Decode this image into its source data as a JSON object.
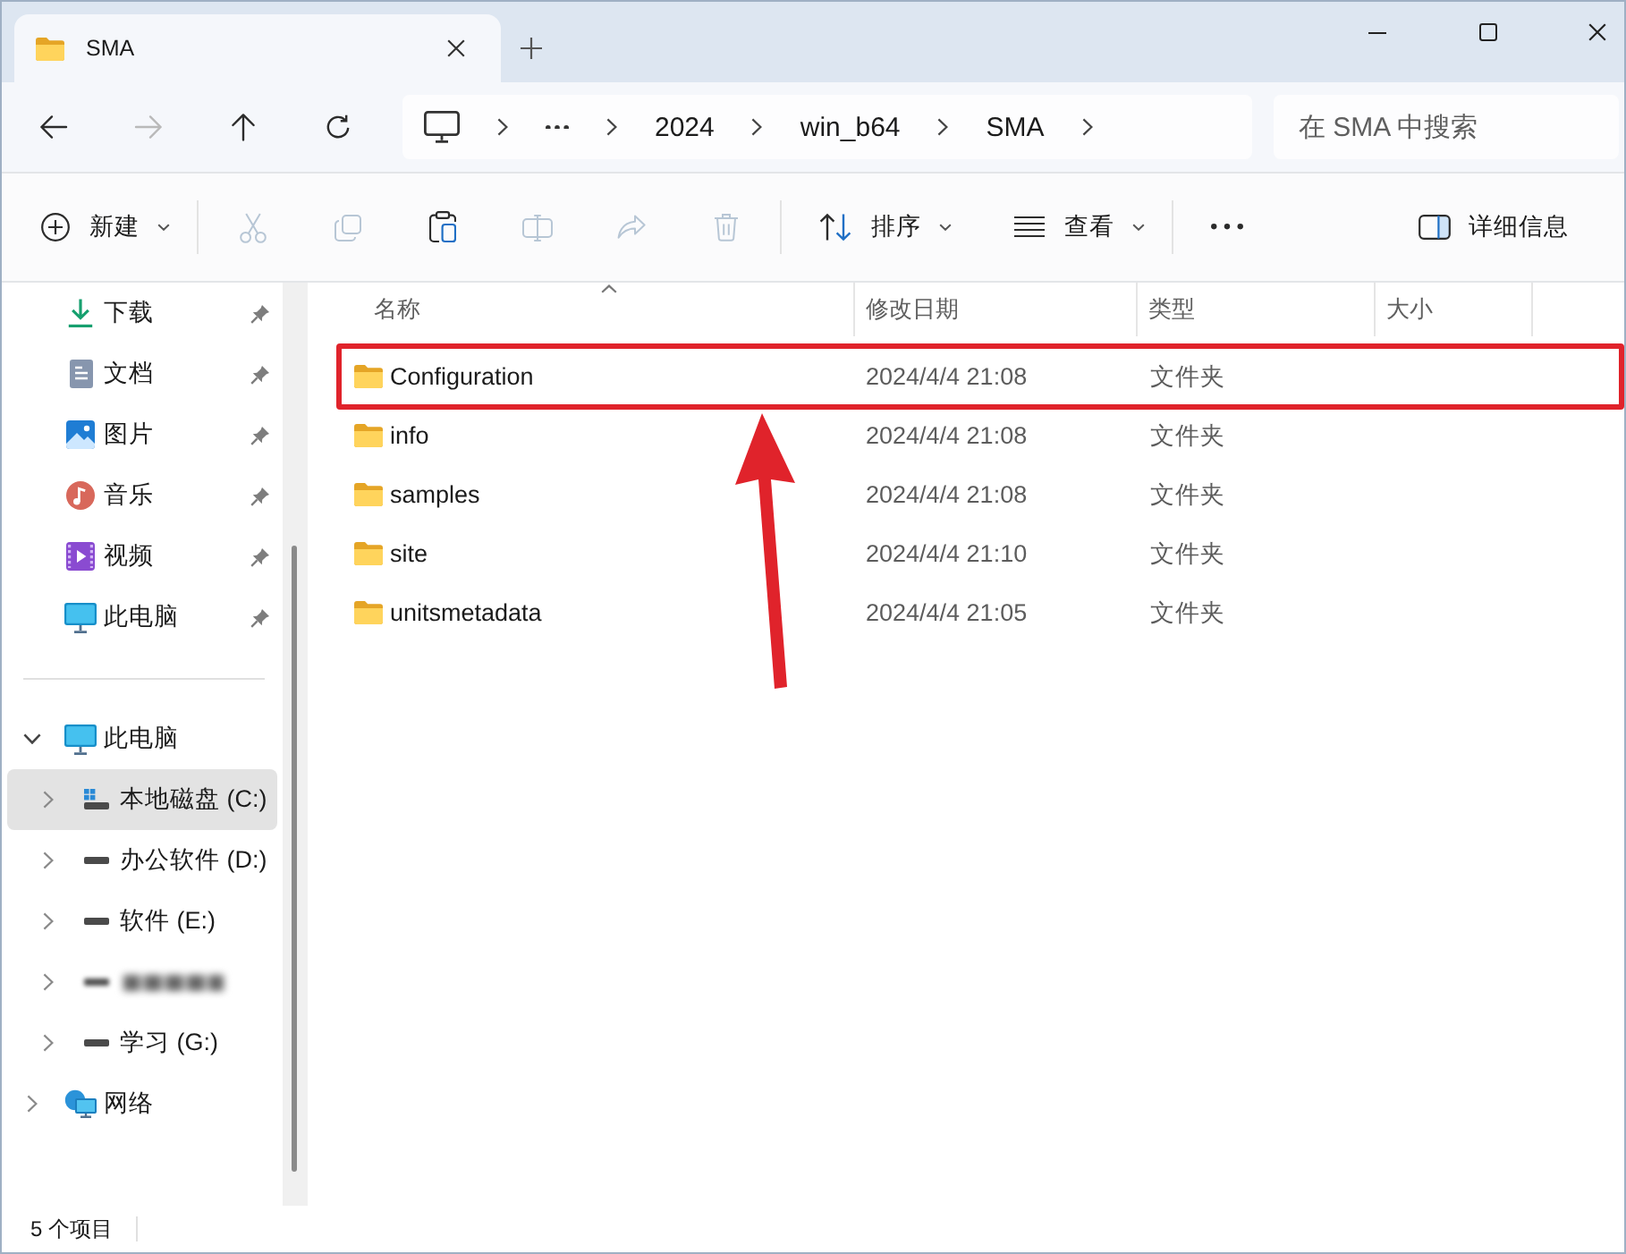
{
  "window": {
    "tab": {
      "title": "SMA",
      "selected": true
    }
  },
  "address_bar": {
    "nav_buttons": [
      {
        "kind": "back",
        "disabled": false
      },
      {
        "kind": "forward",
        "disabled": true
      },
      {
        "kind": "up",
        "disabled": false
      },
      {
        "kind": "refresh",
        "disabled": false
      }
    ],
    "breadcrumb": [
      "2024",
      "win_b64",
      "SMA"
    ],
    "search": {
      "placeholder": "在 SMA 中搜索"
    }
  },
  "toolbar": {
    "groups": [
      [
        {
          "kind": "new",
          "label": "新建",
          "dropdown": true,
          "disabled": false
        }
      ],
      [
        {
          "kind": "cut",
          "dropdown": false,
          "disabled": true
        },
        {
          "kind": "copy",
          "dropdown": false,
          "disabled": true
        },
        {
          "kind": "paste",
          "dropdown": false,
          "disabled": false
        },
        {
          "kind": "rename",
          "dropdown": false,
          "disabled": true
        },
        {
          "kind": "share",
          "dropdown": false,
          "disabled": true
        },
        {
          "kind": "delete",
          "dropdown": false,
          "disabled": true
        }
      ],
      [
        {
          "kind": "sort",
          "label": "排序",
          "dropdown": true,
          "disabled": false
        },
        {
          "kind": "view",
          "label": "查看",
          "dropdown": true,
          "disabled": false
        }
      ],
      [
        {
          "kind": "more",
          "dropdown": false,
          "disabled": false
        }
      ]
    ],
    "details": {
      "label": "详细信息"
    }
  },
  "nav_pane": {
    "quick_access": [
      {
        "kind": "downloads",
        "label": "下载",
        "pinned": true
      },
      {
        "kind": "documents",
        "label": "文档",
        "pinned": true
      },
      {
        "kind": "pictures",
        "label": "图片",
        "pinned": true
      },
      {
        "kind": "music",
        "label": "音乐",
        "pinned": true
      },
      {
        "kind": "videos",
        "label": "视频",
        "pinned": true
      },
      {
        "kind": "pc",
        "label": "此电脑",
        "pinned": true
      }
    ],
    "tree": [
      {
        "kind": "pc",
        "label": "此电脑",
        "expanded": true,
        "selected": false,
        "children": [
          {
            "kind": "system-drive",
            "label": "本地磁盘 (C:)",
            "expanded": false,
            "selected": true
          },
          {
            "kind": "drive",
            "label": "办公软件 (D:)",
            "expanded": false,
            "selected": false
          },
          {
            "kind": "drive",
            "label": "软件 (E:)",
            "expanded": false,
            "selected": false
          },
          {
            "kind": "blurred-drive",
            "expanded": false,
            "selected": false
          },
          {
            "kind": "drive",
            "label": "学习 (G:)",
            "expanded": false,
            "selected": false
          }
        ]
      },
      {
        "kind": "network",
        "label": "网络",
        "expanded": false,
        "selected": false
      }
    ]
  },
  "file_list": {
    "columns": [
      {
        "label": "名称",
        "sorted": true
      },
      {
        "label": "修改日期",
        "sorted": false
      },
      {
        "label": "类型",
        "sorted": false
      },
      {
        "label": "大小",
        "sorted": false
      }
    ],
    "rows": [
      {
        "name": "Configuration",
        "modified": "2024/4/4 21:08",
        "type": "文件夹",
        "highlighted": true
      },
      {
        "name": "info",
        "modified": "2024/4/4 21:08",
        "type": "文件夹",
        "highlighted": false
      },
      {
        "name": "samples",
        "modified": "2024/4/4 21:08",
        "type": "文件夹",
        "highlighted": false
      },
      {
        "name": "site",
        "modified": "2024/4/4 21:10",
        "type": "文件夹",
        "highlighted": false
      },
      {
        "name": "unitsmetadata",
        "modified": "2024/4/4 21:05",
        "type": "文件夹",
        "highlighted": false
      }
    ]
  },
  "annotations": [
    {
      "kind": "arrow"
    }
  ],
  "status_bar": {
    "item_count": "5 个项目"
  }
}
